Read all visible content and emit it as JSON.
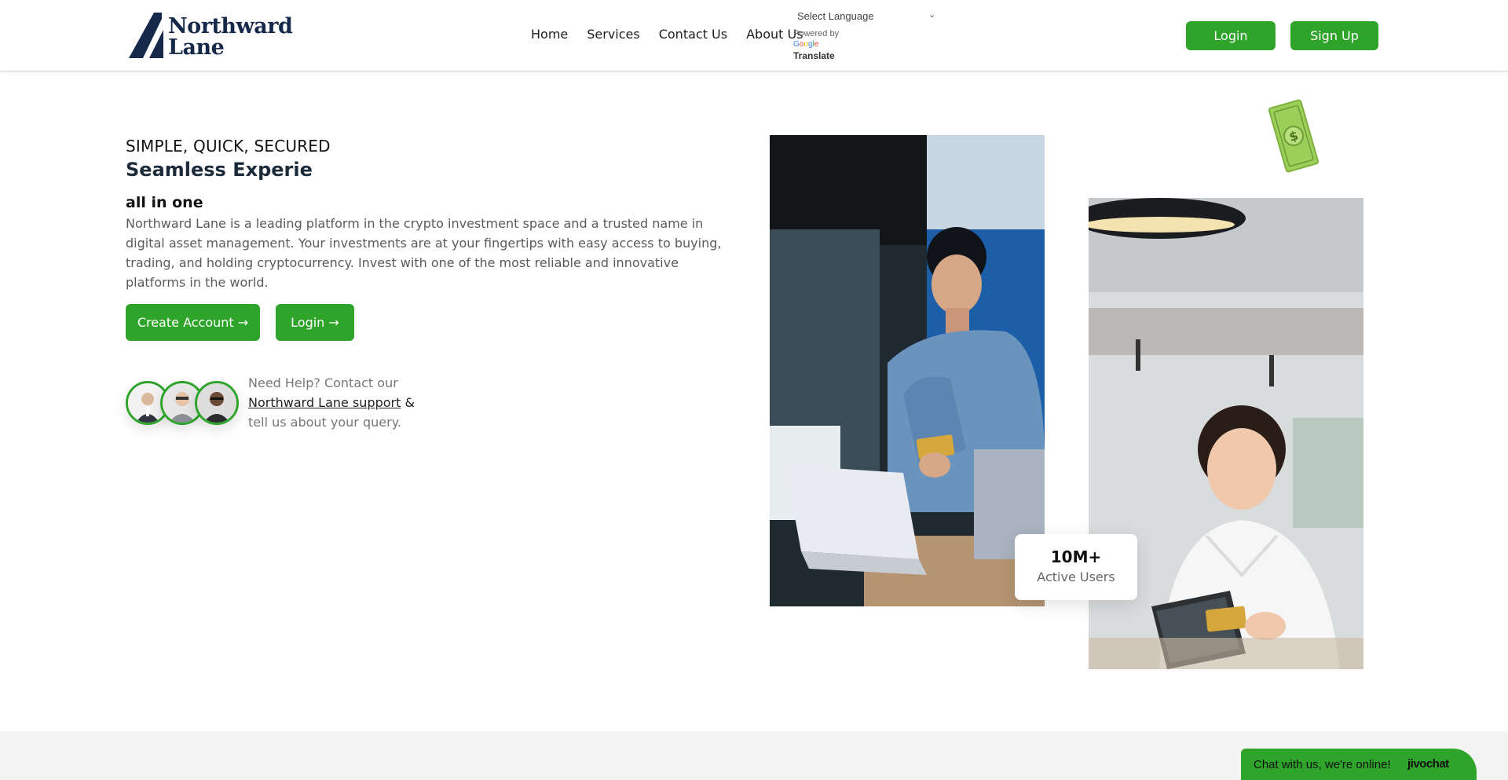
{
  "header": {
    "brand_line1": "Northward",
    "brand_line2": "Lane",
    "nav": [
      "Home",
      "Services",
      "Contact Us",
      "About Us"
    ],
    "translate": {
      "select_label": "Select Language",
      "powered_by": "Powered by",
      "google": "Google",
      "translate_link": "Translate"
    },
    "login_label": "Login",
    "signup_label": "Sign Up"
  },
  "hero": {
    "tagline": "SIMPLE, QUICK, SECURED",
    "headline": "Seamless Experie",
    "subhead": "all in one",
    "description": "Northward Lane is a leading platform in the crypto investment space and a trusted name in digital asset management. Your investments are at your fingertips with easy access to buying, trading, and holding cryptocurrency. Invest with one of the most reliable and innovative platforms in the world.",
    "create_account_label": "Create Account",
    "login_label": "Login",
    "arrow": "→",
    "help_prefix": "Need Help? Contact our",
    "help_link": "Northward Lane support",
    "help_amp": "&",
    "help_suffix": "tell us about your query."
  },
  "stats": {
    "value": "10M+",
    "label": "Active Users"
  },
  "chat": {
    "message": "Chat with us, we're online!",
    "brand": "jivochat"
  },
  "colors": {
    "accent": "#2ea42a",
    "brand_navy": "#16294a"
  }
}
